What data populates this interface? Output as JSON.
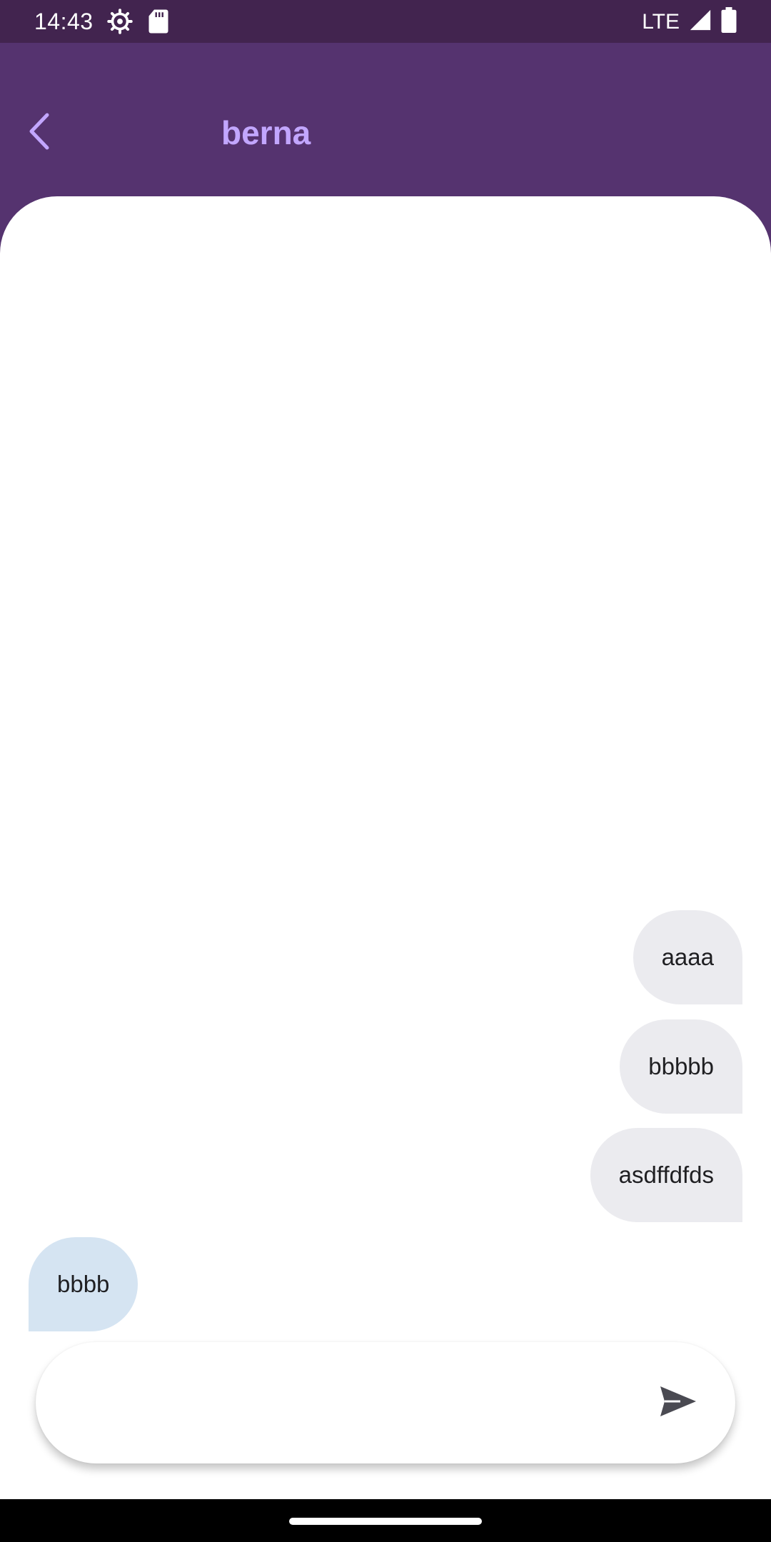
{
  "status_bar": {
    "time": "14:43",
    "network": "LTE",
    "icons": [
      "settings-icon",
      "sd-card-icon",
      "signal-icon",
      "battery-icon"
    ]
  },
  "header": {
    "title": "berna",
    "back_icon": "chevron-left-icon"
  },
  "messages": [
    {
      "text": "aaaa",
      "direction": "sent"
    },
    {
      "text": "bbbbb",
      "direction": "sent"
    },
    {
      "text": "asdffdfds",
      "direction": "sent"
    },
    {
      "text": "bbbb",
      "direction": "received"
    }
  ],
  "composer": {
    "value": "",
    "placeholder": "",
    "send_icon": "send-icon"
  },
  "colors": {
    "app_bar": "#55336f",
    "status_bar": "#42244f",
    "title": "#c2a6ff",
    "sent_bubble": "#ebebef",
    "received_bubble": "#d5e4f2"
  }
}
